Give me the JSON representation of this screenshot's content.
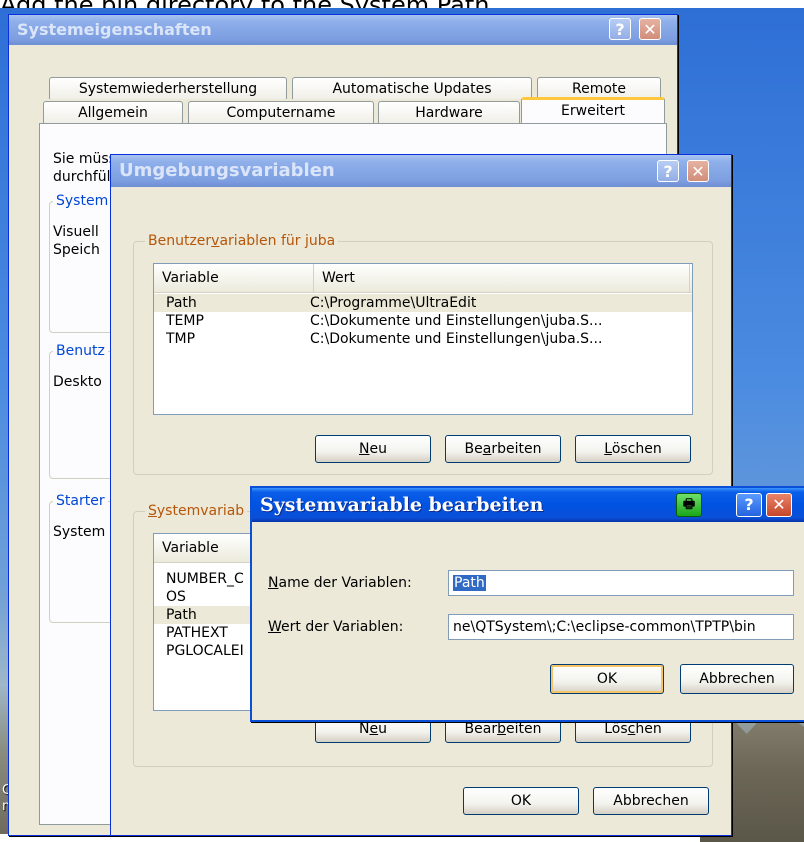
{
  "caption": "Add the bin directory to the System Path.",
  "desktop": {
    "icon_label_line1": "C My",
    "icon_label_line2": "nts"
  },
  "system_properties": {
    "title": "Systemeigenschaften",
    "tabs_row1": [
      "Systemwiederherstellung",
      "Automatische Updates",
      "Remote"
    ],
    "tabs_row2": [
      "Allgemein",
      "Computername",
      "Hardware",
      "Erweitert"
    ],
    "intro_line1": "Sie müss",
    "intro_line2": "durchfül",
    "groups": [
      {
        "label": "System",
        "text1": "Visuell",
        "text2": "Speich"
      },
      {
        "label": "Benutz",
        "text1": "Deskto"
      },
      {
        "label": "Starter",
        "text1": "System"
      }
    ]
  },
  "env_vars": {
    "title": "Umgebungsvariablen",
    "user_group_label": "Benutzervariablen für juba",
    "user_group_label_parts": [
      "Benutzer",
      "v",
      "ariablen für juba"
    ],
    "columns": [
      "Variable",
      "Wert"
    ],
    "user_rows": [
      {
        "variable": "Path",
        "value": "C:\\Programme\\UltraEdit"
      },
      {
        "variable": "TEMP",
        "value": "C:\\Dokumente und Einstellungen\\juba.S..."
      },
      {
        "variable": "TMP",
        "value": "C:\\Dokumente und Einstellungen\\juba.S..."
      }
    ],
    "user_buttons": {
      "new": [
        "",
        "N",
        "eu"
      ],
      "edit": [
        "Be",
        "a",
        "rbeiten"
      ],
      "delete": [
        "",
        "L",
        "öschen"
      ]
    },
    "system_group_label": "Systemvariab",
    "system_group_label_parts": [
      "",
      "S",
      "ystemvariab"
    ],
    "system_rows": [
      {
        "variable": "NUMBER_C"
      },
      {
        "variable": "OS"
      },
      {
        "variable": "Path"
      },
      {
        "variable": "PATHEXT"
      },
      {
        "variable": "PGLOCALEI"
      }
    ],
    "system_buttons": {
      "new": [
        "N",
        "e",
        "u"
      ],
      "edit": [
        "Bear",
        "b",
        "eiten"
      ],
      "delete": [
        "Lös",
        "c",
        "hen"
      ]
    },
    "ok": "OK",
    "cancel": "Abbrechen"
  },
  "edit_dialog": {
    "title": "Systemvariable bearbeiten",
    "name_label_parts": [
      "",
      "N",
      "ame der Variablen:"
    ],
    "value_label_parts": [
      "",
      "W",
      "ert der Variablen:"
    ],
    "name_value": "Path",
    "value_value": "ne\\QTSystem\\;C:\\eclipse-common\\TPTP\\bin",
    "ok": "OK",
    "cancel": "Abbrechen"
  }
}
